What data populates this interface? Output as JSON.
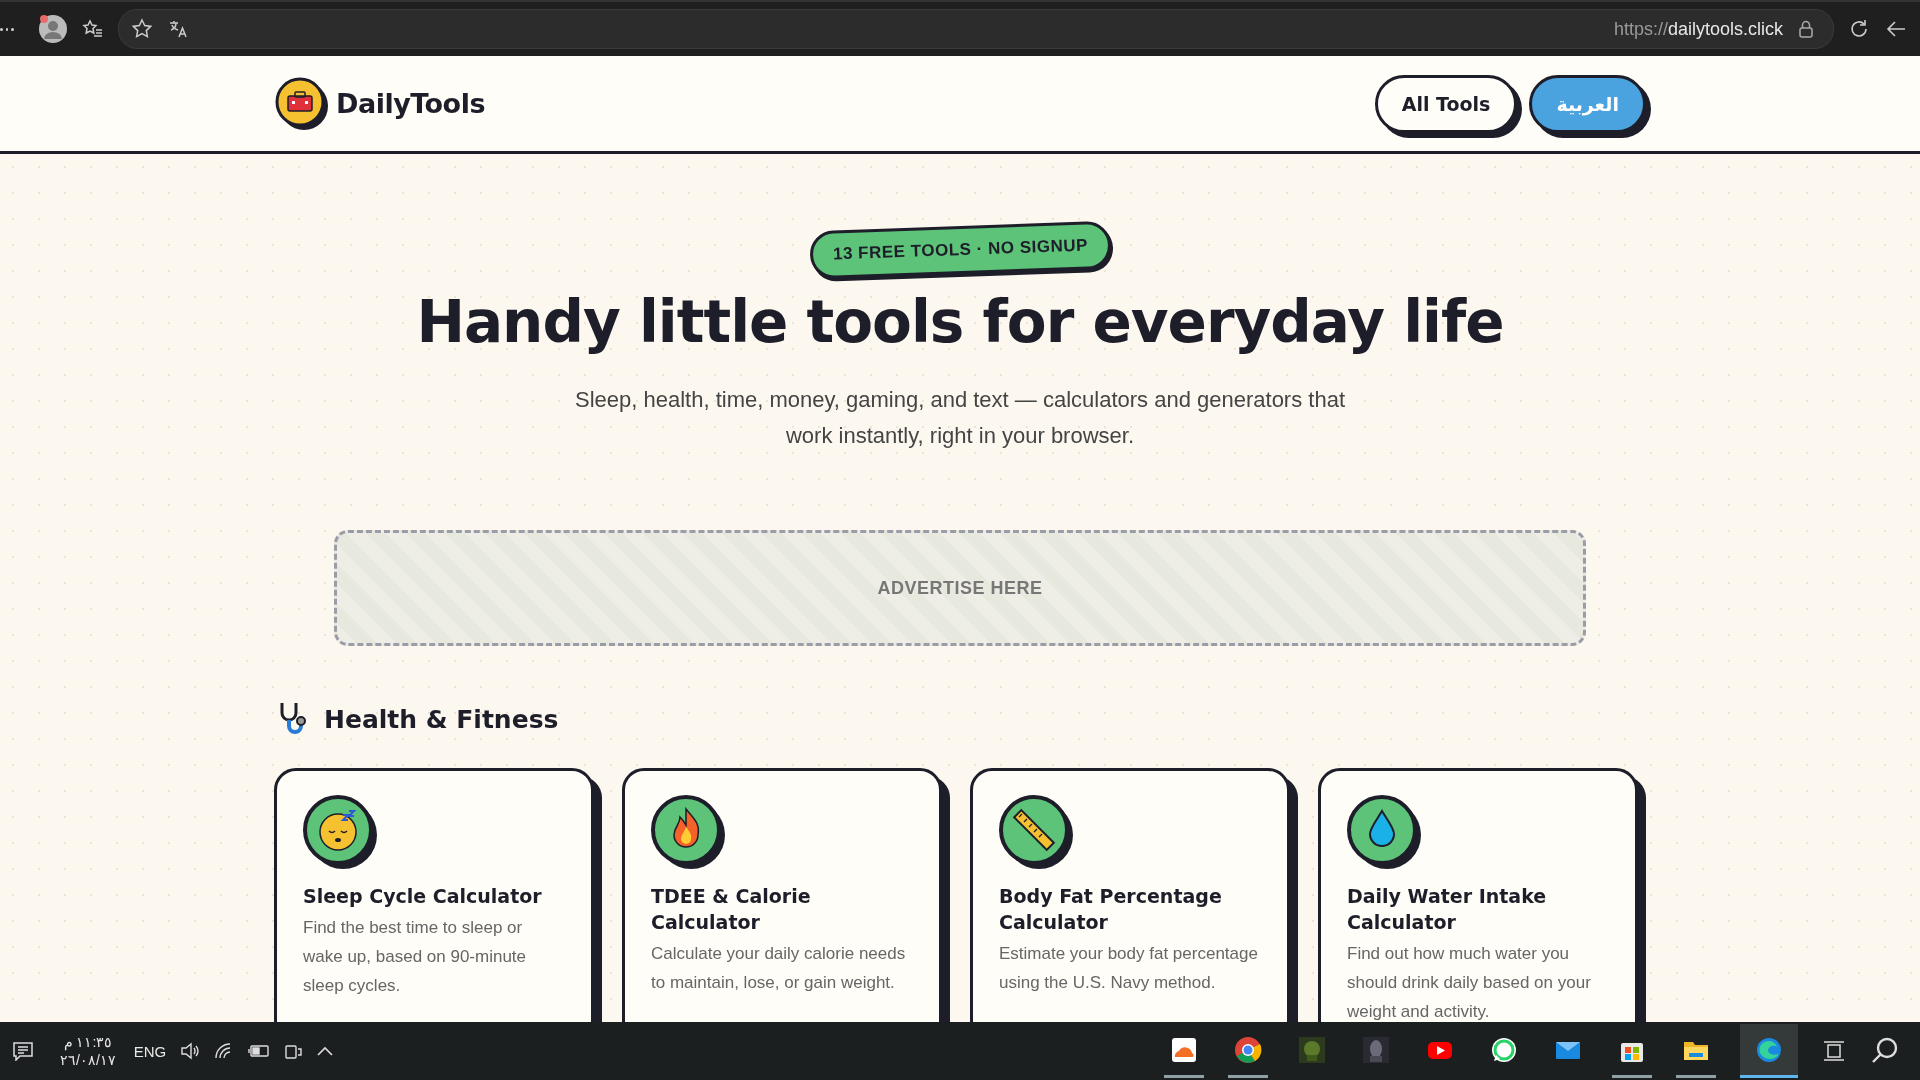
{
  "browser": {
    "url_scheme": "https://",
    "url_host": "dailytools.click"
  },
  "header": {
    "logo": "DailyTools",
    "nav": [
      {
        "label": "All Tools",
        "kind": "outline"
      },
      {
        "label": "العربية",
        "kind": "primary"
      }
    ]
  },
  "hero": {
    "badge": "13 FREE TOOLS · NO SIGNUP",
    "title": "Handy little tools for everyday life",
    "subtitle": "Sleep, health, time, money, gaming, and text — calculators and generators that work instantly, right in your browser."
  },
  "ad": {
    "label": "ADVERTISE HERE"
  },
  "section": {
    "title": "Health & Fitness",
    "cards": [
      {
        "title": "Sleep Cycle Calculator",
        "description": "Find the best time to sleep or wake up, based on 90-minute sleep cycles."
      },
      {
        "title": "TDEE & Calorie Calculator",
        "description": "Calculate your daily calorie needs to maintain, lose, or gain weight."
      },
      {
        "title": "Body Fat Percentage Calculator",
        "description": "Estimate your body fat percentage using the U.S. Navy method."
      },
      {
        "title": "Daily Water Intake Calculator",
        "description": "Find out how much water you should drink daily based on your weight and activity."
      }
    ]
  },
  "taskbar": {
    "time": "١١:٣٥ م",
    "date": "٢٦/٠٨/١٧",
    "language": "ENG",
    "apps": [
      {
        "running": true
      },
      {
        "running": true
      },
      {
        "running": false
      },
      {
        "running": false
      },
      {
        "running": false
      },
      {
        "running": false
      },
      {
        "running": false
      },
      {
        "running": true
      },
      {
        "running": true
      },
      {
        "running": true
      }
    ]
  }
}
